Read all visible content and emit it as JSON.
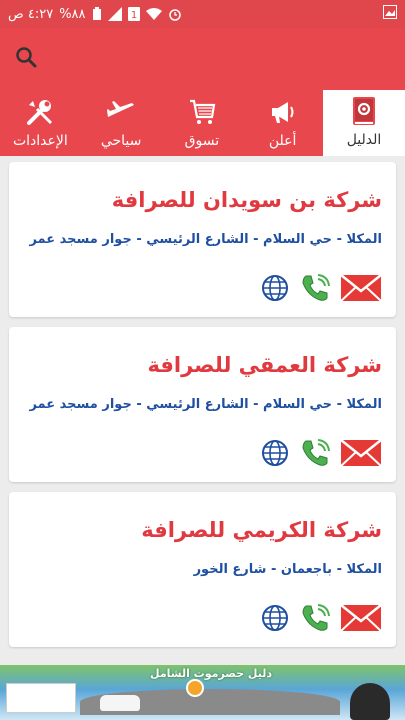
{
  "status": {
    "time": "٤:٢٧ ص",
    "battery": "%٨٨",
    "sim_badge": "1"
  },
  "appbar": {
    "search_icon": "search-icon"
  },
  "tabs": [
    {
      "label": "الإعدادات",
      "icon": "tools-icon"
    },
    {
      "label": "سياحي",
      "icon": "airplane-icon"
    },
    {
      "label": "تسوق",
      "icon": "cart-icon"
    },
    {
      "label": "أعلن",
      "icon": "megaphone-icon"
    },
    {
      "label": "الدليل",
      "icon": "guide-book-icon",
      "active": true
    }
  ],
  "companies": [
    {
      "name": "شركة بن سويدان للصرافة",
      "address": "المكلا - حي السلام - الشارع الرئيسي - جوار مسجد عمر"
    },
    {
      "name": "شركة العمقي للصرافة",
      "address": "المكلا - حي السلام - الشارع الرئيسي - جوار مسجد عمر"
    },
    {
      "name": "شركة الكريمي للصرافة",
      "address": "المكلا - باجعمان - شارع الخور"
    }
  ],
  "banner": {
    "title": "دليل حضرموت الشامل"
  },
  "colors": {
    "primary": "#e8484d",
    "title_red": "#e0393f",
    "address_blue": "#1f4fa0",
    "phone_green": "#4caf50",
    "mail_red": "#e53935",
    "globe_blue": "#1f4fa0"
  }
}
